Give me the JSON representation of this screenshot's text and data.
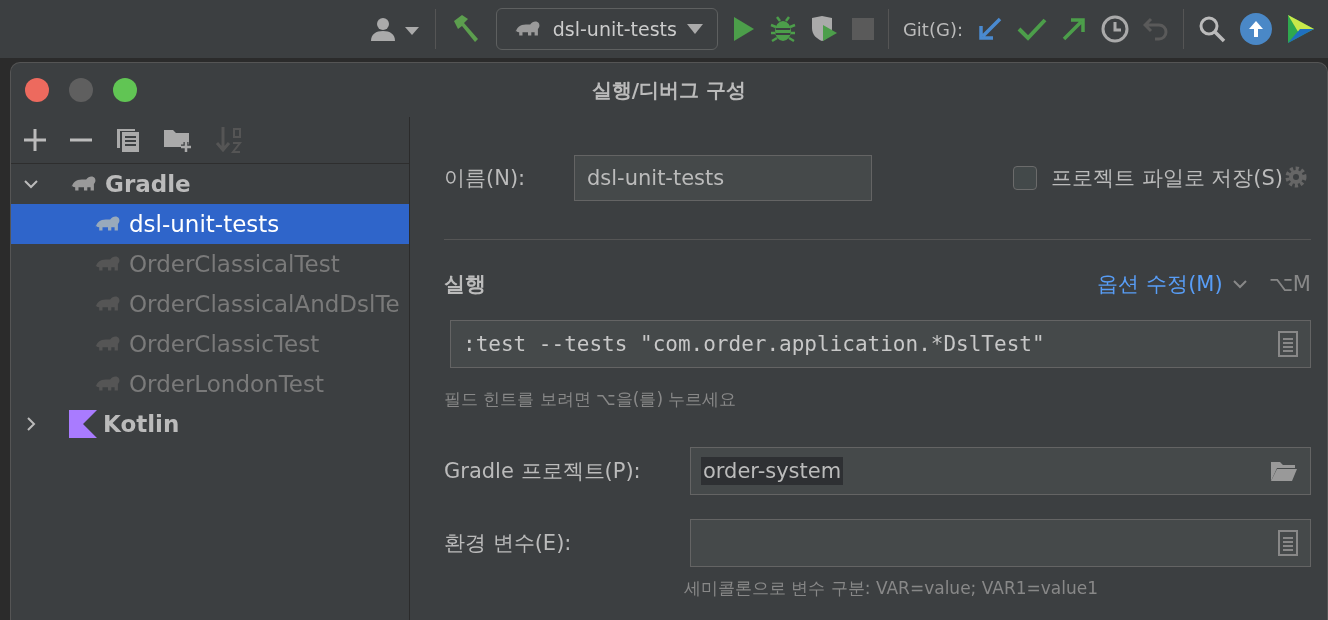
{
  "toolbar": {
    "run_configuration": "dsl-unit-tests",
    "git_label": "Git(G):"
  },
  "window": {
    "title": "실행/디버그 구성"
  },
  "tree": [
    {
      "label": "Gradle",
      "kind": "gradle",
      "expanded": true,
      "children": [
        {
          "label": "dsl-unit-tests",
          "selected": true,
          "temporary": false
        },
        {
          "label": "OrderClassicalTest",
          "selected": false,
          "temporary": true
        },
        {
          "label": "OrderClassicalAndDslTe",
          "selected": false,
          "temporary": true
        },
        {
          "label": "OrderClassicTest",
          "selected": false,
          "temporary": true
        },
        {
          "label": "OrderLondonTest",
          "selected": false,
          "temporary": true
        }
      ]
    },
    {
      "label": "Kotlin",
      "kind": "kotlin",
      "expanded": false
    }
  ],
  "form": {
    "name_label": "이름(N):",
    "name_value": "dsl-unit-tests",
    "store_label": "프로젝트 파일로 저장(S)",
    "store_checked": false,
    "section_title": "실행",
    "modify_options": "옵션 수정(M)",
    "modify_shortcut": "⌥M",
    "command": ":test --tests \"com.order.application.*DslTest\"",
    "command_hint": "필드 힌트를 보려면 ⌥을(를) 누르세요",
    "project_label": "Gradle 프로젝트(P):",
    "project_value": "order-system",
    "env_label": "환경 변수(E):",
    "env_hint": "세미콜론으로 변수 구분: VAR=value; VAR1=value1"
  }
}
